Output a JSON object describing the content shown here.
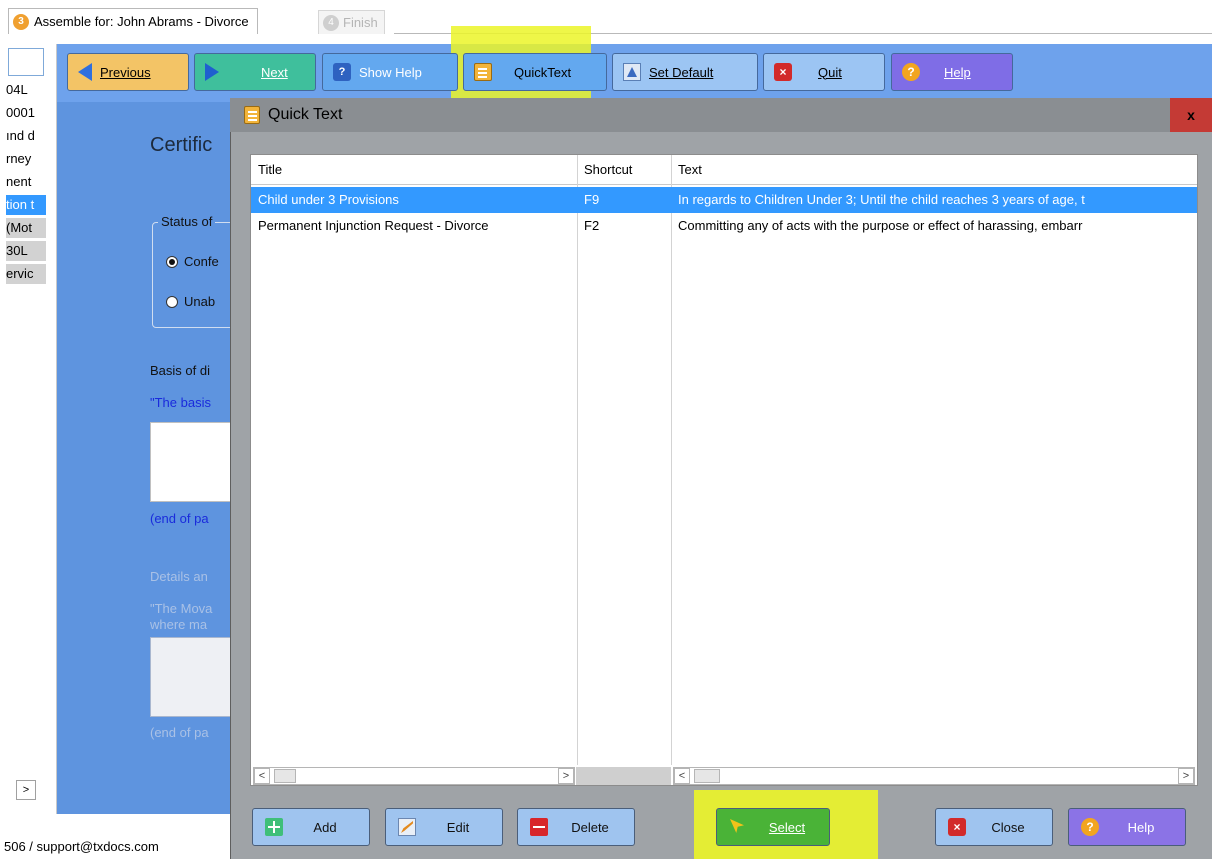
{
  "tabs": {
    "active": {
      "badge": "3",
      "label": "Assemble for: John Abrams - Divorce"
    },
    "disabled": {
      "badge": "4",
      "label": "Finish"
    }
  },
  "left_panel": {
    "items": [
      {
        "text": "04L",
        "state": "normal"
      },
      {
        "text": "0001",
        "state": "normal"
      },
      {
        "text": "ınd d",
        "state": "normal"
      },
      {
        "text": "rney",
        "state": "normal"
      },
      {
        "text": "nent",
        "state": "normal"
      },
      {
        "text": "tion t",
        "state": "selected"
      },
      {
        "text": " (Mot",
        "state": "grey"
      },
      {
        "text": "30L",
        "state": "grey"
      },
      {
        "text": "ervic",
        "state": "grey"
      }
    ],
    "scroll_right": ">"
  },
  "status_bar": "506 / support@txdocs.com",
  "toolbar": {
    "previous": "Previous",
    "next": "Next",
    "show_help": "Show Help",
    "quicktext": "QuickText",
    "set_default": "Set Default",
    "quit": "Quit",
    "help": "Help"
  },
  "form": {
    "certificate": "Certific",
    "status_label": "Status of",
    "radio_conf": "Confe",
    "radio_unab": "Unab",
    "basis_label": "Basis of di",
    "basis_quote": "\"The basis",
    "end_para_1": "(end of pa",
    "details_label": "Details an",
    "movant_line1": "\"The Mova",
    "movant_line2": "where ma",
    "end_para_2": "(end of pa"
  },
  "dialog": {
    "title": "Quick Text",
    "close": "x",
    "columns": [
      "Title",
      "Shortcut",
      "Text"
    ],
    "rows": [
      {
        "title": "Child under 3 Provisions",
        "shortcut": "F9",
        "text": "In regards to Children Under 3; Until the child reaches 3 years of age, t",
        "selected": true
      },
      {
        "title": "Permanent Injunction Request - Divorce",
        "shortcut": "F2",
        "text": "Committing any of acts with the purpose or effect of harassing, embarr",
        "selected": false
      }
    ],
    "buttons": {
      "add": "Add",
      "edit": "Edit",
      "delete": "Delete",
      "select": "Select",
      "close": "Close",
      "help": "Help"
    }
  },
  "colors": {
    "main_blue": "#5e94df",
    "highlight_yellow": "#ebf528",
    "selection_blue": "#3399ff"
  }
}
